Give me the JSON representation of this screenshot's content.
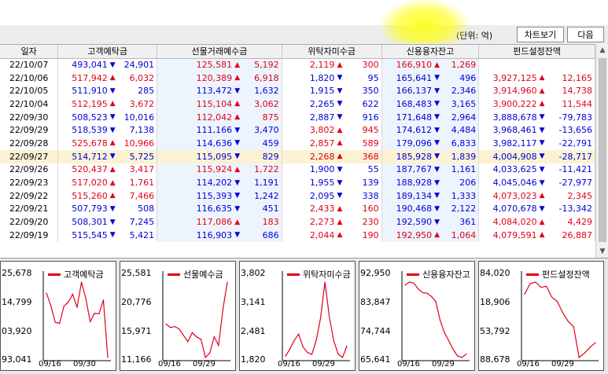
{
  "toolbar": {
    "unit_label": "(단위: 억)",
    "chart_button": "차트보기",
    "next_button": "다음"
  },
  "columns": [
    "일자",
    "고객예탁금",
    "선물거래예수금",
    "위탁자미수금",
    "신용융자잔고",
    "펀드설정잔액"
  ],
  "rows": [
    {
      "date": "22/10/07",
      "c1": [
        "493,041",
        "dn",
        "24,901"
      ],
      "c2": [
        "125,581",
        "up",
        "5,192"
      ],
      "c3": [
        "2,119",
        "up",
        "300"
      ],
      "c4": [
        "166,910",
        "up",
        "1,269"
      ],
      "c5": [
        "",
        "",
        ""
      ]
    },
    {
      "date": "22/10/06",
      "c1": [
        "517,942",
        "up",
        "6,032"
      ],
      "c2": [
        "120,389",
        "up",
        "6,918"
      ],
      "c3": [
        "1,820",
        "dn",
        "95"
      ],
      "c4": [
        "165,641",
        "dn",
        "496"
      ],
      "c5": [
        "3,927,125",
        "up",
        "12,165"
      ]
    },
    {
      "date": "22/10/05",
      "c1": [
        "511,910",
        "dn",
        "285"
      ],
      "c2": [
        "113,472",
        "dn",
        "1,632"
      ],
      "c3": [
        "1,915",
        "dn",
        "350"
      ],
      "c4": [
        "166,137",
        "dn",
        "2,346"
      ],
      "c5": [
        "3,914,960",
        "up",
        "14,738"
      ]
    },
    {
      "date": "22/10/04",
      "c1": [
        "512,195",
        "up",
        "3,672"
      ],
      "c2": [
        "115,104",
        "up",
        "3,062"
      ],
      "c3": [
        "2,265",
        "dn",
        "622"
      ],
      "c4": [
        "168,483",
        "dn",
        "3,165"
      ],
      "c5": [
        "3,900,222",
        "up",
        "11,544"
      ]
    },
    {
      "date": "22/09/30",
      "c1": [
        "508,523",
        "dn",
        "10,016"
      ],
      "c2": [
        "112,042",
        "up",
        "875"
      ],
      "c3": [
        "2,887",
        "dn",
        "916"
      ],
      "c4": [
        "171,648",
        "dn",
        "2,964"
      ],
      "c5": [
        "3,888,678",
        "dn",
        "-79,783"
      ]
    },
    {
      "date": "22/09/29",
      "c1": [
        "518,539",
        "dn",
        "7,138"
      ],
      "c2": [
        "111,166",
        "dn",
        "3,470"
      ],
      "c3": [
        "3,802",
        "up",
        "945"
      ],
      "c4": [
        "174,612",
        "dn",
        "4,484"
      ],
      "c5": [
        "3,968,461",
        "dn",
        "-13,656"
      ]
    },
    {
      "date": "22/09/28",
      "c1": [
        "525,678",
        "up",
        "10,966"
      ],
      "c2": [
        "114,636",
        "dn",
        "459"
      ],
      "c3": [
        "2,857",
        "up",
        "589"
      ],
      "c4": [
        "179,096",
        "dn",
        "6,833"
      ],
      "c5": [
        "3,982,117",
        "dn",
        "-22,791"
      ]
    },
    {
      "date": "22/09/27",
      "c1": [
        "514,712",
        "dn",
        "5,725"
      ],
      "c2": [
        "115,095",
        "dn",
        "829"
      ],
      "c3": [
        "2,268",
        "up",
        "368"
      ],
      "c4": [
        "185,928",
        "dn",
        "1,839"
      ],
      "c5": [
        "4,004,908",
        "dn",
        "-28,717"
      ],
      "selected": true
    },
    {
      "date": "22/09/26",
      "c1": [
        "520,437",
        "up",
        "3,417"
      ],
      "c2": [
        "115,924",
        "up",
        "1,722"
      ],
      "c3": [
        "1,900",
        "dn",
        "55"
      ],
      "c4": [
        "187,767",
        "dn",
        "1,161"
      ],
      "c5": [
        "4,033,625",
        "dn",
        "-11,421"
      ]
    },
    {
      "date": "22/09/23",
      "c1": [
        "517,020",
        "up",
        "1,761"
      ],
      "c2": [
        "114,202",
        "dn",
        "1,191"
      ],
      "c3": [
        "1,955",
        "dn",
        "139"
      ],
      "c4": [
        "188,928",
        "dn",
        "206"
      ],
      "c5": [
        "4,045,046",
        "dn",
        "-27,977"
      ]
    },
    {
      "date": "22/09/22",
      "c1": [
        "515,260",
        "up",
        "7,466"
      ],
      "c2": [
        "115,393",
        "dn",
        "1,242"
      ],
      "c3": [
        "2,095",
        "dn",
        "338"
      ],
      "c4": [
        "189,134",
        "dn",
        "1,333"
      ],
      "c5": [
        "4,073,023",
        "up",
        "2,345"
      ]
    },
    {
      "date": "22/09/21",
      "c1": [
        "507,793",
        "dn",
        "508"
      ],
      "c2": [
        "116,635",
        "dn",
        "451"
      ],
      "c3": [
        "2,433",
        "up",
        "160"
      ],
      "c4": [
        "190,468",
        "dn",
        "2,122"
      ],
      "c5": [
        "4,070,678",
        "dn",
        "-13,342"
      ]
    },
    {
      "date": "22/09/20",
      "c1": [
        "508,301",
        "dn",
        "7,245"
      ],
      "c2": [
        "117,086",
        "up",
        "183"
      ],
      "c3": [
        "2,273",
        "up",
        "230"
      ],
      "c4": [
        "192,590",
        "dn",
        "361"
      ],
      "c5": [
        "4,084,020",
        "up",
        "4,429"
      ]
    },
    {
      "date": "22/09/19",
      "c1": [
        "515,545",
        "dn",
        "5,421"
      ],
      "c2": [
        "116,903",
        "dn",
        "686"
      ],
      "c3": [
        "2,044",
        "up",
        "190"
      ],
      "c4": [
        "192,950",
        "up",
        "1,064"
      ],
      "c5": [
        "4,079,591",
        "up",
        "26,887"
      ]
    }
  ],
  "arrows": {
    "up": "▲",
    "dn": "▼"
  },
  "scrollbar": {
    "up_icon": "▲",
    "down_icon": "▼"
  },
  "colors": {
    "up": "#e0001a",
    "down": "#0000d8",
    "line": "#e0001a",
    "selected_row": "#fbf2d4"
  },
  "panels": [
    {
      "legend": "고객예탁금",
      "y_ticks": [
        "25,678",
        "14,799",
        "03,920",
        "93,041"
      ],
      "x_ticks": [
        "09/16",
        "09/30"
      ],
      "chart_data": {
        "type": "line",
        "x": [
          "09/16",
          "09/19",
          "09/20",
          "09/21",
          "09/22",
          "09/23",
          "09/26",
          "09/27",
          "09/28",
          "09/29",
          "09/30",
          "10/04",
          "10/05",
          "10/06",
          "10/07"
        ],
        "values": [
          520966,
          515545,
          508301,
          507793,
          515260,
          517020,
          520437,
          514712,
          525678,
          518539,
          508523,
          512195,
          511910,
          517942,
          493041
        ],
        "ylim": [
          493041,
          525678
        ]
      }
    },
    {
      "legend": "선물예수금",
      "y_ticks": [
        "25,581",
        "20,776",
        "15,971",
        "11,166"
      ],
      "x_ticks": [
        "09/16",
        "09/29"
      ],
      "chart_data": {
        "type": "line",
        "x": [
          "09/16",
          "09/19",
          "09/20",
          "09/21",
          "09/22",
          "09/23",
          "09/26",
          "09/27",
          "09/28",
          "09/29",
          "09/30",
          "10/04",
          "10/05",
          "10/06",
          "10/07"
        ],
        "values": [
          117589,
          116903,
          117086,
          116635,
          115393,
          114202,
          115924,
          115095,
          114636,
          111166,
          112042,
          115104,
          113472,
          120389,
          125581
        ],
        "ylim": [
          111166,
          125581
        ]
      }
    },
    {
      "legend": "위탁자미수금",
      "y_ticks": [
        "3,802",
        "3,141",
        "2,481",
        "1,820"
      ],
      "x_ticks": [
        "09/16",
        "09/29"
      ],
      "chart_data": {
        "type": "line",
        "x": [
          "09/16",
          "09/19",
          "09/20",
          "09/21",
          "09/22",
          "09/23",
          "09/26",
          "09/27",
          "09/28",
          "09/29",
          "09/30",
          "10/04",
          "10/05",
          "10/06",
          "10/07"
        ],
        "values": [
          1854,
          2044,
          2273,
          2433,
          2095,
          1955,
          1900,
          2268,
          2857,
          3802,
          2887,
          2265,
          1915,
          1820,
          2119
        ],
        "ylim": [
          1820,
          3802
        ]
      }
    },
    {
      "legend": "신용융자잔고",
      "y_ticks": [
        "92,950",
        "83,847",
        "74,744",
        "65,641"
      ],
      "x_ticks": [
        "09/16",
        "09/29"
      ],
      "chart_data": {
        "type": "line",
        "x": [
          "09/16",
          "09/19",
          "09/20",
          "09/21",
          "09/22",
          "09/23",
          "09/26",
          "09/27",
          "09/28",
          "09/29",
          "09/30",
          "10/04",
          "10/05",
          "10/06",
          "10/07"
        ],
        "values": [
          191886,
          192950,
          192590,
          190468,
          189134,
          188928,
          187767,
          185928,
          179096,
          174612,
          171648,
          168483,
          166137,
          165641,
          166910
        ],
        "ylim": [
          165641,
          192950
        ]
      }
    },
    {
      "legend": "펀드설정잔액",
      "y_ticks": [
        "84,020",
        "18,906",
        "53,792",
        "88,678"
      ],
      "x_ticks": [
        "09/16",
        "09/29"
      ],
      "chart_data": {
        "type": "line",
        "x": [
          "09/16",
          "09/19",
          "09/20",
          "09/21",
          "09/22",
          "09/23",
          "09/26",
          "09/27",
          "09/28",
          "09/29",
          "09/30",
          "10/04",
          "10/05",
          "10/06",
          "10/07"
        ],
        "values": [
          4052704,
          4079591,
          4084020,
          4070678,
          4073023,
          4045046,
          4033625,
          4004908,
          3982117,
          3968461,
          3888678,
          3900222,
          3914960,
          3927125
        ],
        "ylim": [
          3888678,
          4084020
        ]
      }
    }
  ]
}
